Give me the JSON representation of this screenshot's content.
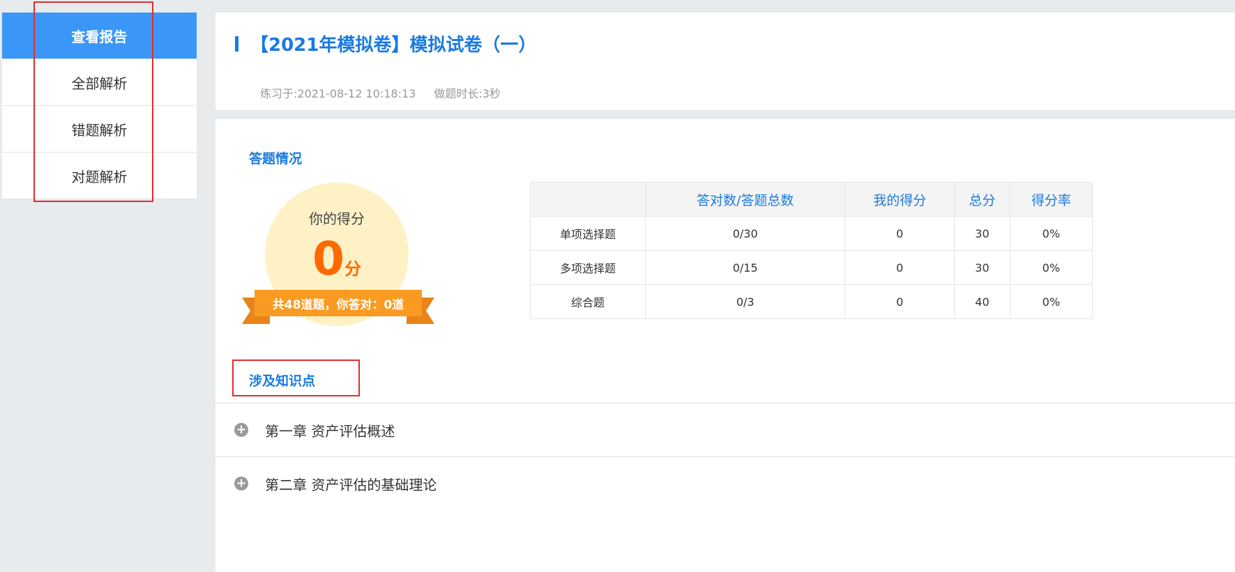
{
  "sidebar": {
    "items": [
      {
        "label": "查看报告"
      },
      {
        "label": "全部解析"
      },
      {
        "label": "错题解析"
      },
      {
        "label": "对题解析"
      }
    ]
  },
  "header": {
    "title": "【2021年模拟卷】模拟试卷（一）",
    "practiced_at": "练习于:2021-08-12 10:18:13",
    "duration": "做题时长:3秒"
  },
  "summary": {
    "section_title": "答题情况",
    "score_label": "你的得分",
    "score": "0",
    "score_unit": "分",
    "ribbon": "共48道题，你答对：0道"
  },
  "table": {
    "headers": [
      "",
      "答对数/答题总数",
      "我的得分",
      "总分",
      "得分率"
    ],
    "rows": [
      [
        "单项选择题",
        "0/30",
        "0",
        "30",
        "0%"
      ],
      [
        "多项选择题",
        "0/15",
        "0",
        "30",
        "0%"
      ],
      [
        "综合题",
        "0/3",
        "0",
        "40",
        "0%"
      ]
    ]
  },
  "knowledge": {
    "section_title": "涉及知识点",
    "chapters": [
      {
        "label": "第一章 资产评估概述"
      },
      {
        "label": "第二章 资产评估的基础理论"
      }
    ]
  },
  "colors": {
    "accent": "#1a7ae0",
    "active": "#3a97f8",
    "score": "#ff6a00",
    "ribbon": "#f99b22",
    "highlight": "#e32b2b"
  }
}
